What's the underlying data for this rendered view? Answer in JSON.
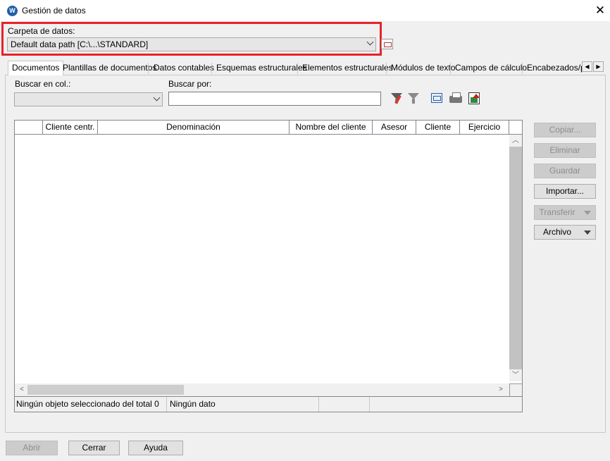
{
  "window": {
    "title": "Gestión de datos",
    "app_icon_letter": "W",
    "close_glyph": "✕"
  },
  "data_folder": {
    "label": "Carpeta de datos:",
    "value": "Default data path [C:\\...\\STANDARD]",
    "highlight_color": "#e8222a"
  },
  "tabs": [
    {
      "label": "Documentos",
      "active": true
    },
    {
      "label": "Plantillas de documentos",
      "active": false
    },
    {
      "label": "Datos contables",
      "active": false
    },
    {
      "label": "Esquemas estructurales",
      "active": false
    },
    {
      "label": "Elementos estructurales",
      "active": false
    },
    {
      "label": "Módulos de texto",
      "active": false
    },
    {
      "label": "Campos de cálculo",
      "active": false
    },
    {
      "label": "Encabezados/p",
      "active": false
    }
  ],
  "tab_scroll": {
    "left": "◀",
    "right": "▶"
  },
  "search": {
    "column_label": "Buscar en col.:",
    "column_value": "",
    "term_label": "Buscar por:",
    "term_value": ""
  },
  "toolbar_icons": [
    "filter-edit-icon",
    "filter-icon",
    "columns-icon",
    "print-icon",
    "export-icon"
  ],
  "grid": {
    "columns": [
      "",
      "Cliente centr.",
      "Denominación",
      "Nombre del cliente",
      "Asesor",
      "Cliente",
      "Ejercicio"
    ],
    "rows": [],
    "scroll_up": "︿",
    "scroll_down": "﹀",
    "scroll_left": "<",
    "scroll_right": ">"
  },
  "status_bar": {
    "selection": "Ningún objeto seleccionado del total 0",
    "data": "Ningún dato",
    "cell3": "",
    "cell4": ""
  },
  "side_buttons": {
    "copy": "Copiar...",
    "delete": "Eliminar",
    "save": "Guardar",
    "import": "Importar...",
    "transfer": "Transferir",
    "file": "Archivo"
  },
  "bottom_buttons": {
    "open": "Abrir",
    "close": "Cerrar",
    "help": "Ayuda"
  }
}
